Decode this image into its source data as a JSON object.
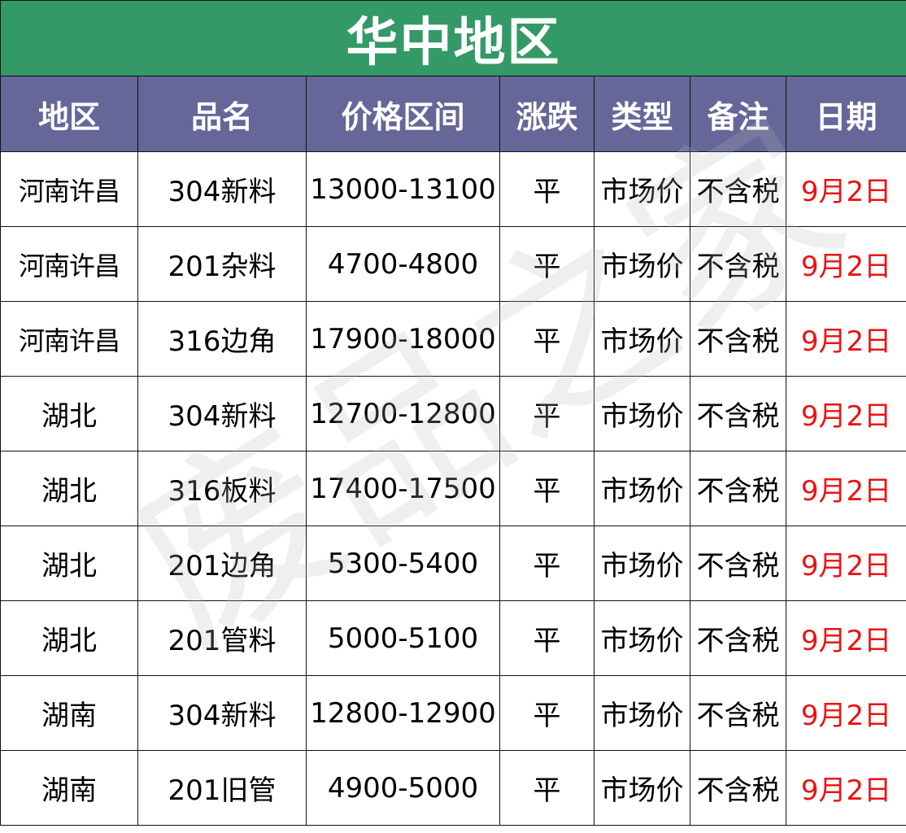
{
  "title": "华中地区",
  "columns": [
    "地区",
    "品名",
    "价格区间",
    "涨跌",
    "类型",
    "备注",
    "日期"
  ],
  "rows": [
    {
      "region": "河南许昌",
      "product": "304新料",
      "price_range": "13000-13100",
      "change": "平",
      "type": "市场价",
      "note": "不含税",
      "date": "9月2日"
    },
    {
      "region": "河南许昌",
      "product": "201杂料",
      "price_range": "4700-4800",
      "change": "平",
      "type": "市场价",
      "note": "不含税",
      "date": "9月2日"
    },
    {
      "region": "河南许昌",
      "product": "316边角",
      "price_range": "17900-18000",
      "change": "平",
      "type": "市场价",
      "note": "不含税",
      "date": "9月2日"
    },
    {
      "region": "湖北",
      "product": "304新料",
      "price_range": "12700-12800",
      "change": "平",
      "type": "市场价",
      "note": "不含税",
      "date": "9月2日"
    },
    {
      "region": "湖北",
      "product": "316板料",
      "price_range": "17400-17500",
      "change": "平",
      "type": "市场价",
      "note": "不含税",
      "date": "9月2日"
    },
    {
      "region": "湖北",
      "product": "201边角",
      "price_range": "5300-5400",
      "change": "平",
      "type": "市场价",
      "note": "不含税",
      "date": "9月2日"
    },
    {
      "region": "湖北",
      "product": "201管料",
      "price_range": "5000-5100",
      "change": "平",
      "type": "市场价",
      "note": "不含税",
      "date": "9月2日"
    },
    {
      "region": "湖南",
      "product": "304新料",
      "price_range": "12800-12900",
      "change": "平",
      "type": "市场价",
      "note": "不含税",
      "date": "9月2日"
    },
    {
      "region": "湖南",
      "product": "201旧管",
      "price_range": "4900-5000",
      "change": "平",
      "type": "市场价",
      "note": "不含税",
      "date": "9月2日"
    }
  ],
  "watermark": "废品之家",
  "colors": {
    "title_bg": "#339966",
    "header_bg": "#666699",
    "date_text": "#ee1111",
    "border": "#111111"
  }
}
